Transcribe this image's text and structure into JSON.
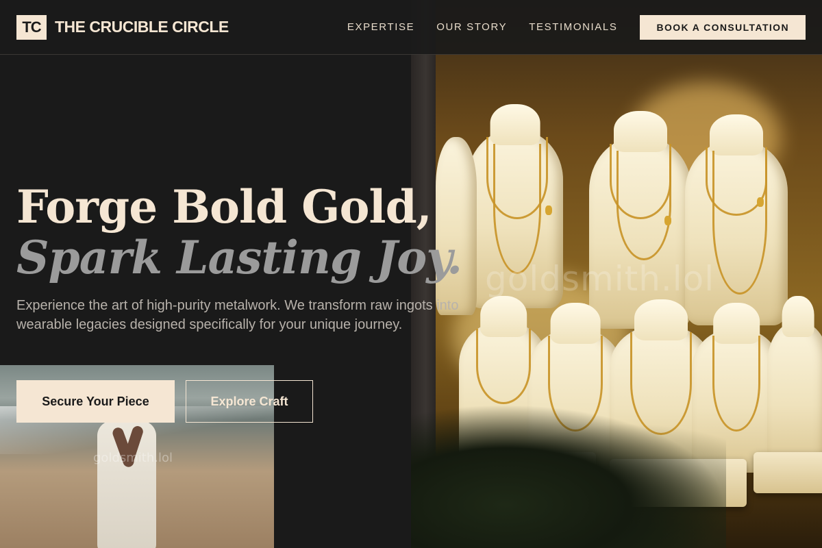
{
  "brand": {
    "mark": "TC",
    "name": "THE CRUCIBLE CIRCLE"
  },
  "nav": {
    "links": [
      "EXPERTISE",
      "OUR STORY",
      "TESTIMONIALS"
    ],
    "cta": "BOOK A CONSULTATION"
  },
  "hero": {
    "title_line1": "Forge Bold Gold,",
    "title_line2": "Spark Lasting Joy.",
    "description": "Experience the art of high-purity metalwork. We transform raw ingots into wearable legacies designed specifically for your unique journey.",
    "primary_cta": "Secure Your Piece",
    "secondary_cta": "Explore Craft"
  },
  "watermarks": {
    "main": "goldsmith.lol",
    "inset": "goldsmith.lol"
  },
  "colors": {
    "background": "#1a1a1a",
    "cream": "#f5e6d3",
    "muted_title": "#9b9b9b",
    "gold": "#c9952a"
  }
}
